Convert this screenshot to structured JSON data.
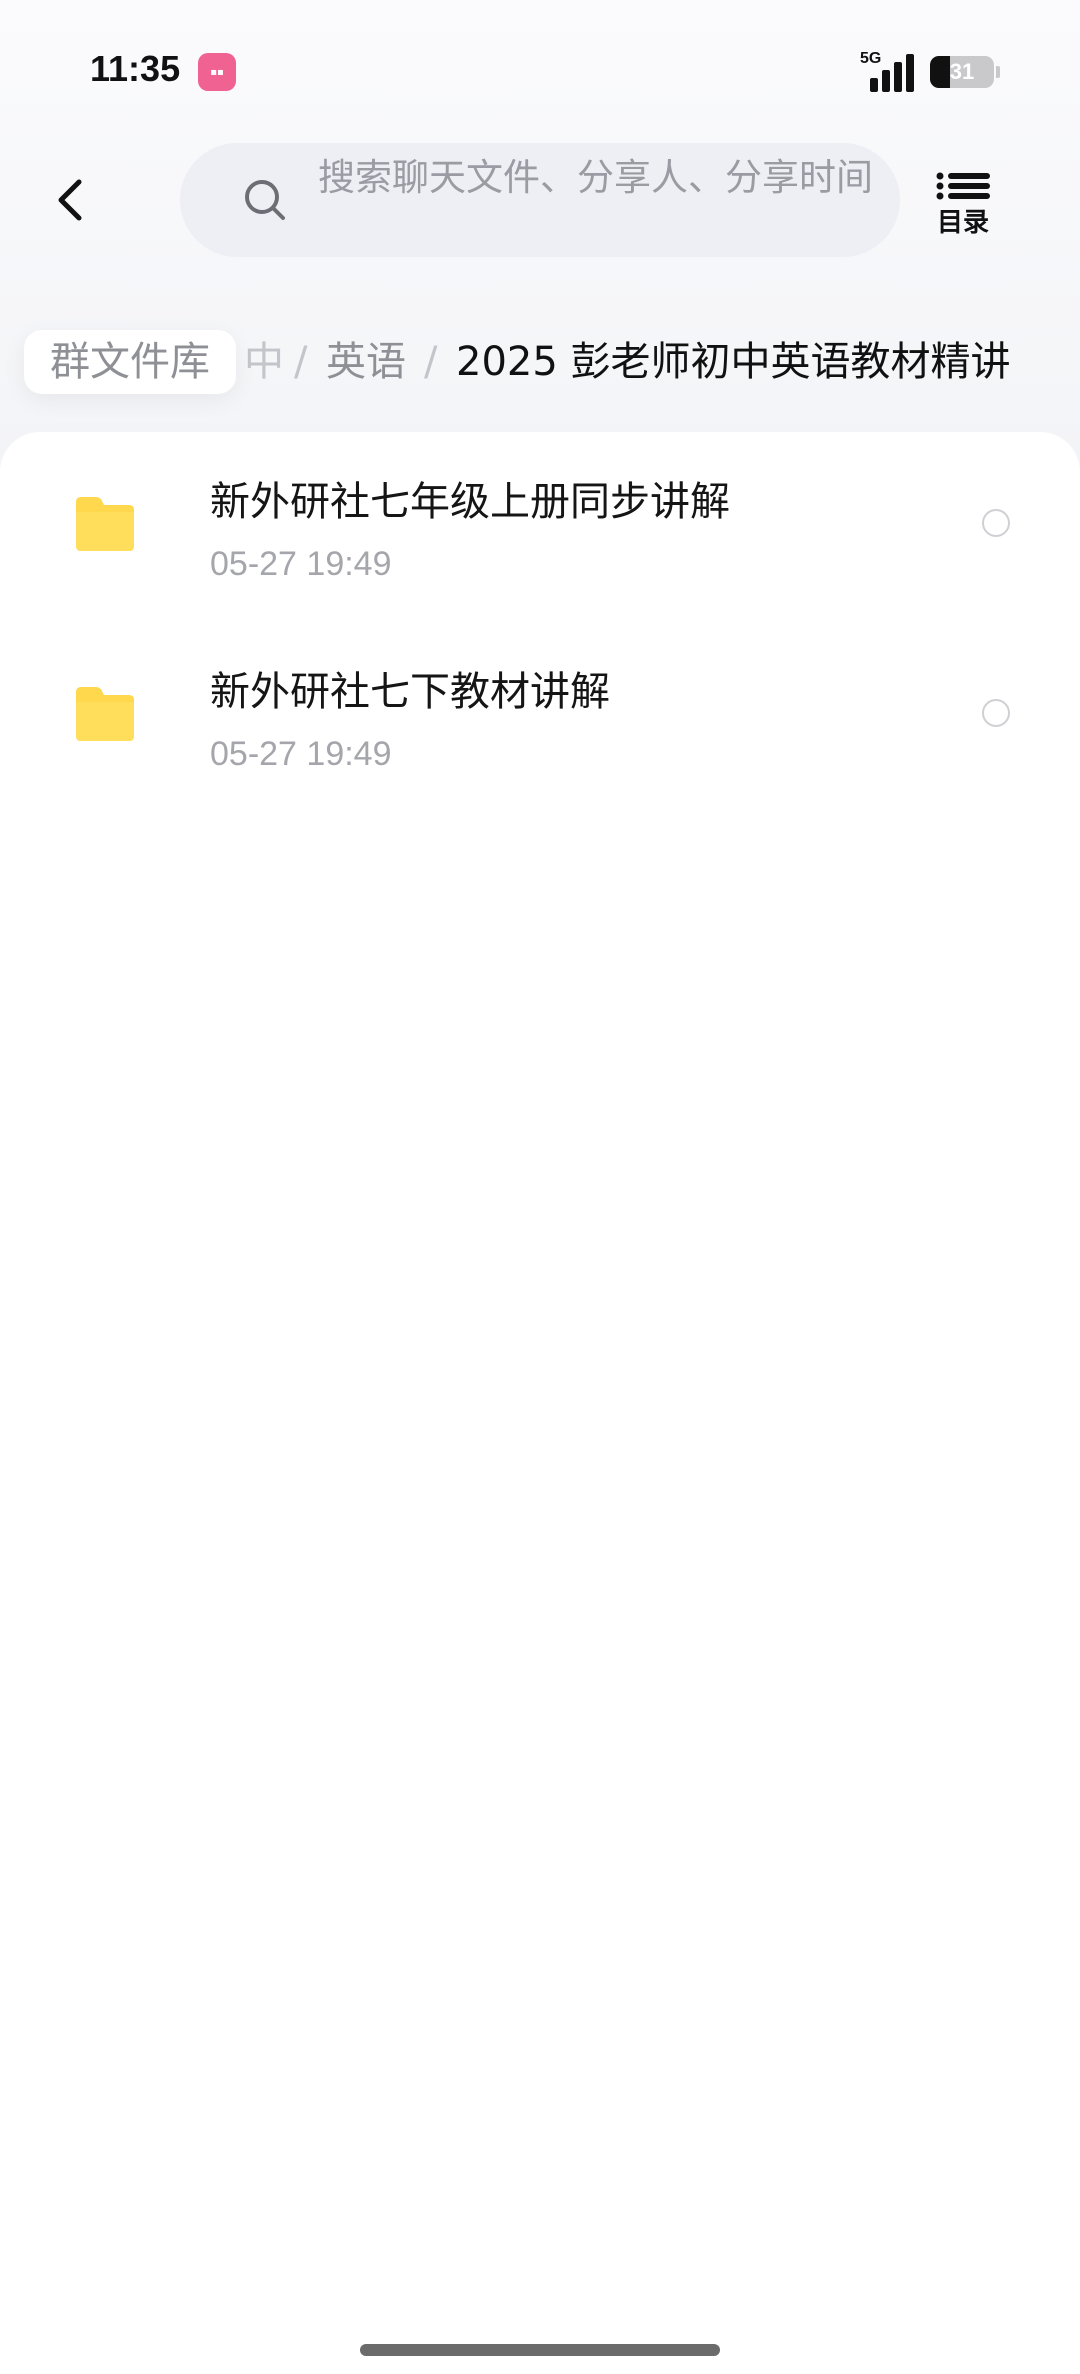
{
  "status_bar": {
    "time": "11:35",
    "network": "5G",
    "signal_level": 4,
    "battery_level": 31,
    "battery_text": "31"
  },
  "header": {
    "search": {
      "placeholder": "搜索聊天文件、分享人、分享时间"
    },
    "menu_label": "目录"
  },
  "breadcrumb": {
    "root": "群文件库",
    "faded": "中",
    "middle": "英语",
    "separator": "/",
    "current": "2025 彭老师初中英语教材精讲"
  },
  "files": [
    {
      "name": "新外研社七年级上册同步讲解",
      "time": "05-27  19:49",
      "icon": "folder-icon"
    },
    {
      "name": "新外研社七下教材讲解",
      "time": "05-27  19:49",
      "icon": "folder-icon"
    }
  ],
  "colors": {
    "folder": "#ffd84d",
    "app_badge": "#f06292",
    "accent_text": "#111111"
  }
}
